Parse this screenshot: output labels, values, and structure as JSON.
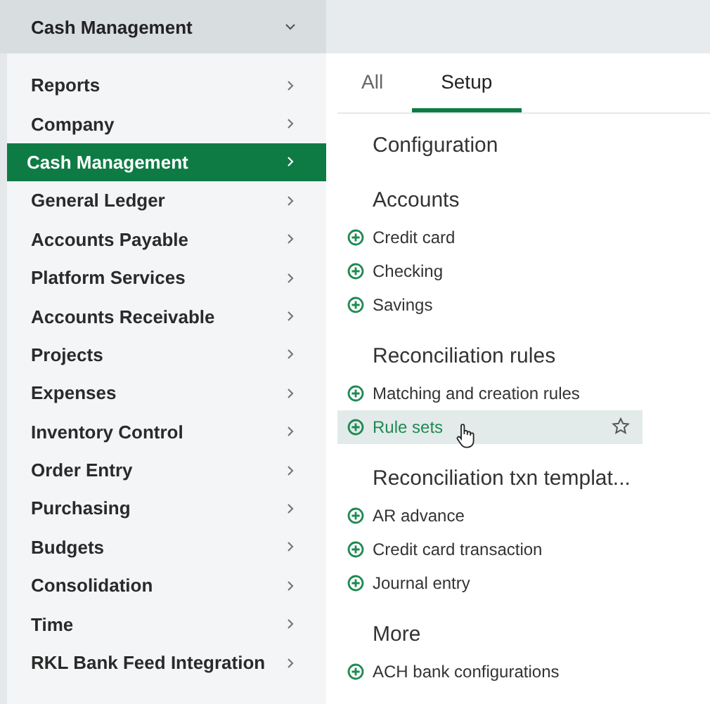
{
  "top_bar": {
    "module": "Cash Management"
  },
  "menu": [
    {
      "label": "Reports",
      "selected": false
    },
    {
      "label": "Company",
      "selected": false
    },
    {
      "label": "Cash Management",
      "selected": true
    },
    {
      "label": "General Ledger",
      "selected": false
    },
    {
      "label": "Accounts Payable",
      "selected": false
    },
    {
      "label": "Platform Services",
      "selected": false
    },
    {
      "label": "Accounts Receivable",
      "selected": false
    },
    {
      "label": "Projects",
      "selected": false
    },
    {
      "label": "Expenses",
      "selected": false
    },
    {
      "label": "Inventory Control",
      "selected": false
    },
    {
      "label": "Order Entry",
      "selected": false
    },
    {
      "label": "Purchasing",
      "selected": false
    },
    {
      "label": "Budgets",
      "selected": false
    },
    {
      "label": "Consolidation",
      "selected": false
    },
    {
      "label": "Time",
      "selected": false
    },
    {
      "label": "RKL Bank Feed Integration",
      "selected": false
    }
  ],
  "tabs": [
    {
      "label": "All",
      "selected": false
    },
    {
      "label": "Setup",
      "selected": true
    }
  ],
  "sections": [
    {
      "title": "Configuration"
    },
    {
      "title": "Accounts",
      "items": [
        {
          "label": "Credit card",
          "highlighted": false
        },
        {
          "label": "Checking",
          "highlighted": false
        },
        {
          "label": "Savings",
          "highlighted": false
        }
      ]
    },
    {
      "title": "Reconciliation rules",
      "items": [
        {
          "label": "Matching and creation rules",
          "highlighted": false
        },
        {
          "label": "Rule sets",
          "highlighted": true
        }
      ]
    },
    {
      "title": "Reconciliation txn templat...",
      "items": [
        {
          "label": "AR advance",
          "highlighted": false
        },
        {
          "label": "Credit card transaction",
          "highlighted": false
        },
        {
          "label": "Journal entry",
          "highlighted": false
        }
      ]
    },
    {
      "title": "More",
      "items": [
        {
          "label": "ACH bank configurations",
          "highlighted": false
        }
      ]
    }
  ]
}
